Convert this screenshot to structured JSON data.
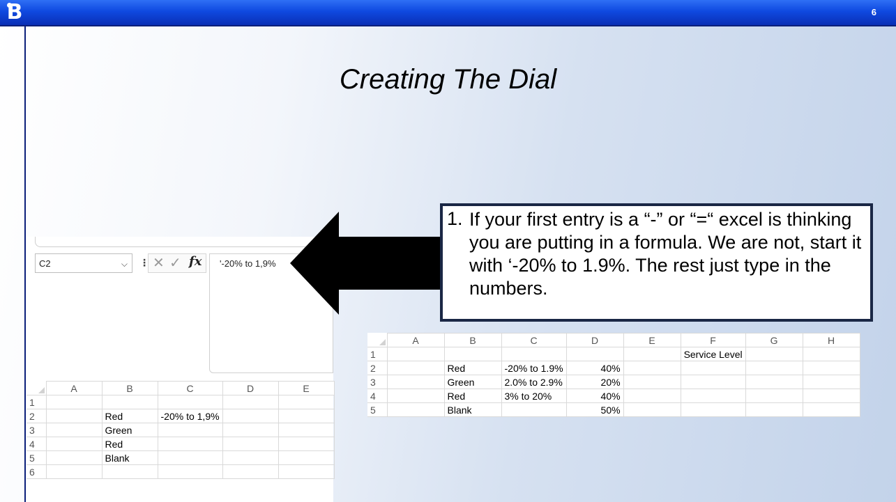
{
  "slide": {
    "number": "6",
    "title": "Creating The Dial"
  },
  "excel_left": {
    "name_box": "C2",
    "formula_bar_icons": [
      "cancel-icon",
      "enter-check-icon",
      "fx-icon"
    ],
    "formula_value": "'-20% to 1,9%",
    "columns": [
      "A",
      "B",
      "C",
      "D",
      "E"
    ],
    "rows": [
      {
        "n": "1",
        "cells": [
          "",
          "",
          "",
          "",
          ""
        ]
      },
      {
        "n": "2",
        "cells": [
          "",
          "Red",
          "-20% to 1,9%",
          "",
          ""
        ]
      },
      {
        "n": "3",
        "cells": [
          "",
          "Green",
          "",
          "",
          ""
        ]
      },
      {
        "n": "4",
        "cells": [
          "",
          "Red",
          "",
          "",
          ""
        ]
      },
      {
        "n": "5",
        "cells": [
          "",
          "Blank",
          "",
          "",
          ""
        ]
      },
      {
        "n": "6",
        "cells": [
          "",
          "",
          "",
          "",
          ""
        ]
      }
    ]
  },
  "excel_right": {
    "columns": [
      "A",
      "B",
      "C",
      "D",
      "E",
      "F",
      "G",
      "H"
    ],
    "rows": [
      {
        "n": "1",
        "cells": [
          "",
          "",
          "",
          "",
          "",
          "Service Level",
          "",
          ""
        ]
      },
      {
        "n": "2",
        "cells": [
          "",
          "Red",
          "-20% to 1.9%",
          "40%",
          "",
          "",
          "",
          ""
        ]
      },
      {
        "n": "3",
        "cells": [
          "",
          "Green",
          "2.0% to 2.9%",
          "20%",
          "",
          "",
          "",
          ""
        ]
      },
      {
        "n": "4",
        "cells": [
          "",
          "Red",
          "3% to 20%",
          "40%",
          "",
          "",
          "",
          ""
        ]
      },
      {
        "n": "5",
        "cells": [
          "",
          "Blank",
          "",
          "50%",
          "",
          "",
          "",
          ""
        ]
      }
    ]
  },
  "callout": {
    "number": "1.",
    "text": "If your first entry is a “-” or “=“ excel is thinking you are putting in a formula. We are not, start it with ‘-20% to 1.9%. The rest just type in the numbers."
  },
  "colors": {
    "header_blue": "#0f49e0",
    "callout_border": "#1a2745",
    "arrow": "#000000"
  }
}
